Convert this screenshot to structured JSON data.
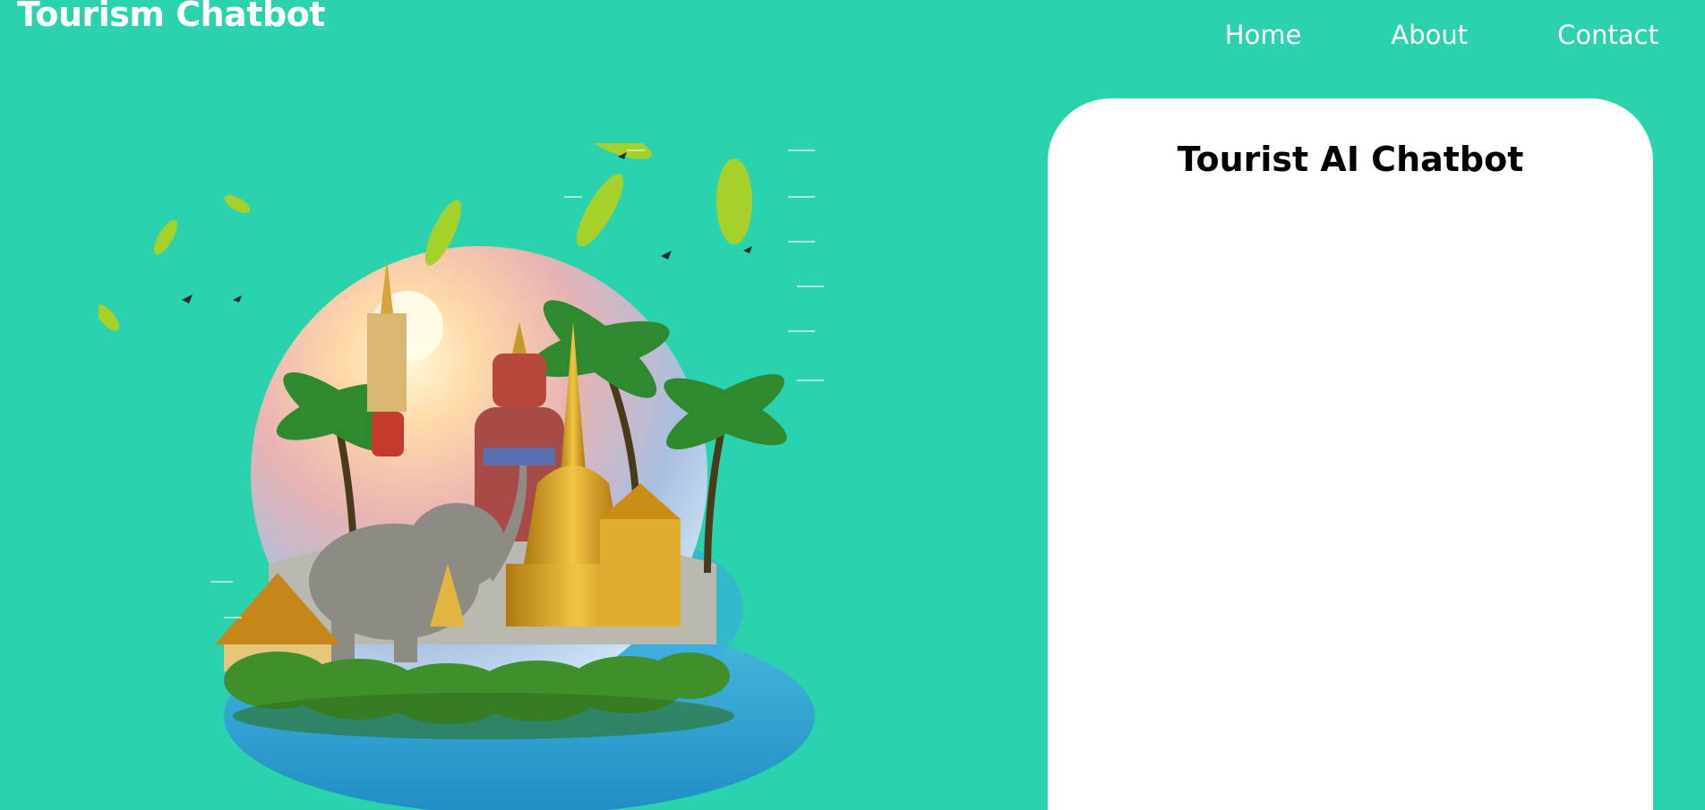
{
  "header": {
    "brand": "Tourism Chatbot",
    "nav": [
      {
        "label": "Home"
      },
      {
        "label": "About"
      },
      {
        "label": "Contact"
      }
    ]
  },
  "chat": {
    "title": "Tourist AI Chatbot"
  },
  "colors": {
    "background": "#2ad3ae",
    "panel": "#ffffff",
    "header_text": "#ffffff",
    "title_text": "#000000"
  },
  "hero": {
    "icon": "thailand-landmarks-illustration"
  }
}
